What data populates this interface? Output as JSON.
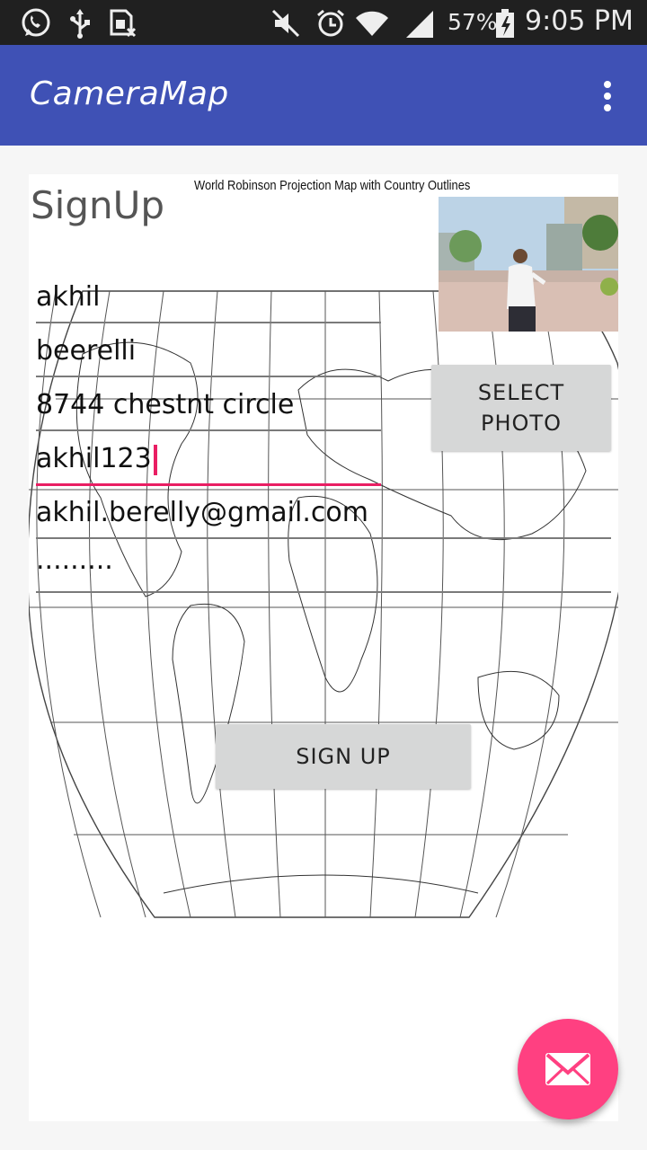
{
  "status_bar": {
    "battery_percent": "57%",
    "time": "9:05 PM",
    "icons": [
      "whatsapp-icon",
      "usb-icon",
      "sim-icon",
      "mute-icon",
      "alarm-icon",
      "wifi-icon",
      "signal-icon",
      "battery-icon"
    ]
  },
  "app_bar": {
    "title": "CameraMap",
    "overflow_icon": "more-vert-icon"
  },
  "form": {
    "title": "SignUp",
    "map_caption": "World Robinson Projection Map with Country Outlines",
    "fields": [
      {
        "value": "akhil"
      },
      {
        "value": "beerelli"
      },
      {
        "value": "8744 chestnt circle"
      },
      {
        "value": "akhil123"
      },
      {
        "value": "akhil.berelly@gmail.com"
      },
      {
        "value": "........."
      }
    ],
    "select_photo_label": "SELECT PHOTO",
    "signup_label": "SIGN UP"
  },
  "fab": {
    "icon": "mail-icon"
  },
  "colors": {
    "app_bar": "#3f51b5",
    "accent": "#ff4081",
    "field_focus": "#e91e63",
    "button": "#d6d7d7"
  }
}
